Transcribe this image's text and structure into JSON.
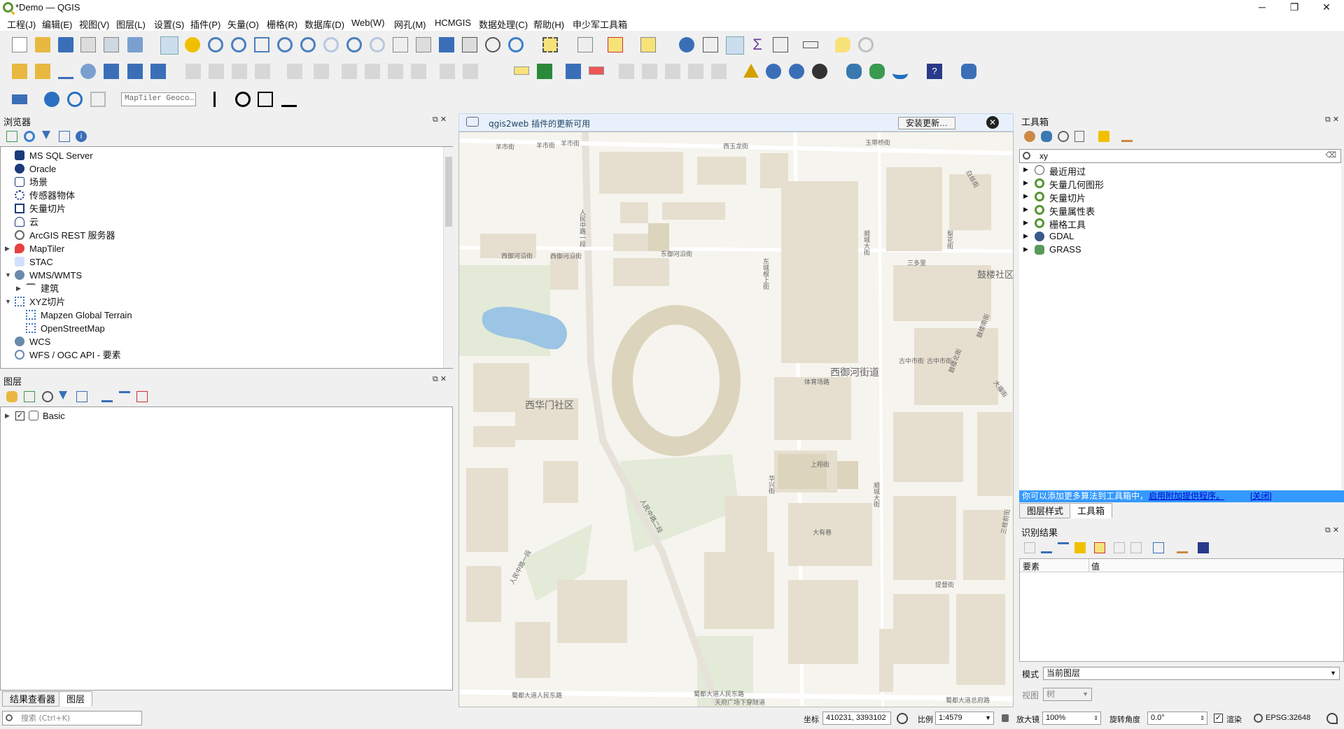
{
  "window": {
    "title": "*Demo — QGIS",
    "minimize": "─",
    "maximize": "❐",
    "close": "✕"
  },
  "menu": [
    "工程(J)",
    "编辑(E)",
    "视图(V)",
    "图层(L)",
    "设置(S)",
    "插件(P)",
    "矢量(O)",
    "栅格(R)",
    "数据库(D)",
    "Web(W)",
    "网孔(M)",
    "HCMGIS",
    "数据处理(C)",
    "帮助(H)",
    "申少军工具箱"
  ],
  "geocoder": {
    "placeholder": "MapTiler Geoco…"
  },
  "browser": {
    "title": "浏览器",
    "items": [
      {
        "label": "MS SQL Server",
        "icon": "mssql-icon"
      },
      {
        "label": "Oracle",
        "icon": "oracle-icon"
      },
      {
        "label": "场景",
        "icon": "scene-icon"
      },
      {
        "label": "传感器物体",
        "icon": "sensor-icon"
      },
      {
        "label": "矢量切片",
        "icon": "vector-tile-icon"
      },
      {
        "label": "云",
        "icon": "cloud-icon"
      },
      {
        "label": "ArcGIS REST 服务器",
        "icon": "arcgis-icon"
      },
      {
        "label": "MapTiler",
        "icon": "maptiler-icon"
      },
      {
        "label": "STAC",
        "icon": "stac-icon"
      },
      {
        "label": "WMS/WMTS",
        "icon": "wms-icon"
      },
      {
        "label": "建筑",
        "icon": "building-icon"
      },
      {
        "label": "XYZ切片",
        "icon": "xyz-icon"
      },
      {
        "label": "Mapzen Global Terrain",
        "icon": "tile-icon"
      },
      {
        "label": "OpenStreetMap",
        "icon": "tile-icon"
      },
      {
        "label": "WCS",
        "icon": "wcs-icon"
      },
      {
        "label": "WFS / OGC API - 要素",
        "icon": "wfs-icon"
      }
    ]
  },
  "layers": {
    "title": "图层",
    "items": [
      {
        "label": "Basic",
        "checked": true
      }
    ]
  },
  "left_tabs": [
    "结果查看器",
    "图层"
  ],
  "search": {
    "placeholder": "搜索 (Ctrl+K)"
  },
  "message": {
    "text": "qgis2web 插件的更新可用",
    "button": "安装更新…",
    "close": "✕"
  },
  "toolbox": {
    "title": "工具箱",
    "search_value": "xy",
    "items": [
      "最近用过",
      "矢量几何图形",
      "矢量切片",
      "矢量属性表",
      "栅格工具",
      "GDAL",
      "GRASS"
    ],
    "note": "你可以添加更多算法到工具箱中，",
    "note_link": "启用附加提供程序。",
    "note_close": "[关闭]",
    "tabs": [
      "图层样式",
      "工具箱"
    ]
  },
  "identify": {
    "title": "识别结果",
    "columns": [
      "要素",
      "值"
    ],
    "mode_label": "模式",
    "mode_value": "当前图层",
    "view_label": "视图",
    "view_value": "树"
  },
  "map_labels": [
    "羊市街",
    "羊市街",
    "羊市街",
    "西玉龙街",
    "玉带桥街",
    "白丝街",
    "人民中路一段",
    "西御河沿街",
    "西御河沿街",
    "东御河沿街",
    "东城根上街",
    "三多里",
    "鼓楼社区",
    "西御河街道",
    "古中市街",
    "古中市街",
    "体育场路",
    "西华门社区",
    "上翔街",
    "人民中路二段",
    "人民中路一段",
    "大有巷",
    "蜀都大道人民东路",
    "蜀都大道人民东路",
    "天府广场下穿隧道",
    "蜀都大道总府路",
    "提督街",
    "顺城大街",
    "梨花街",
    "鼓楼南街",
    "鼓楼北街",
    "大福街",
    "华兴街",
    "三桂前街",
    "顺城大街"
  ],
  "status": {
    "coord_label": "坐标",
    "coord_value": "410231, 3393102",
    "scale_label": "比例",
    "scale_value": "1:4579",
    "magnifier_label": "放大镜",
    "magnifier_value": "100%",
    "rotation_label": "旋转角度",
    "rotation_value": "0.0°",
    "render_label": "渲染",
    "crs": "EPSG:32648"
  }
}
